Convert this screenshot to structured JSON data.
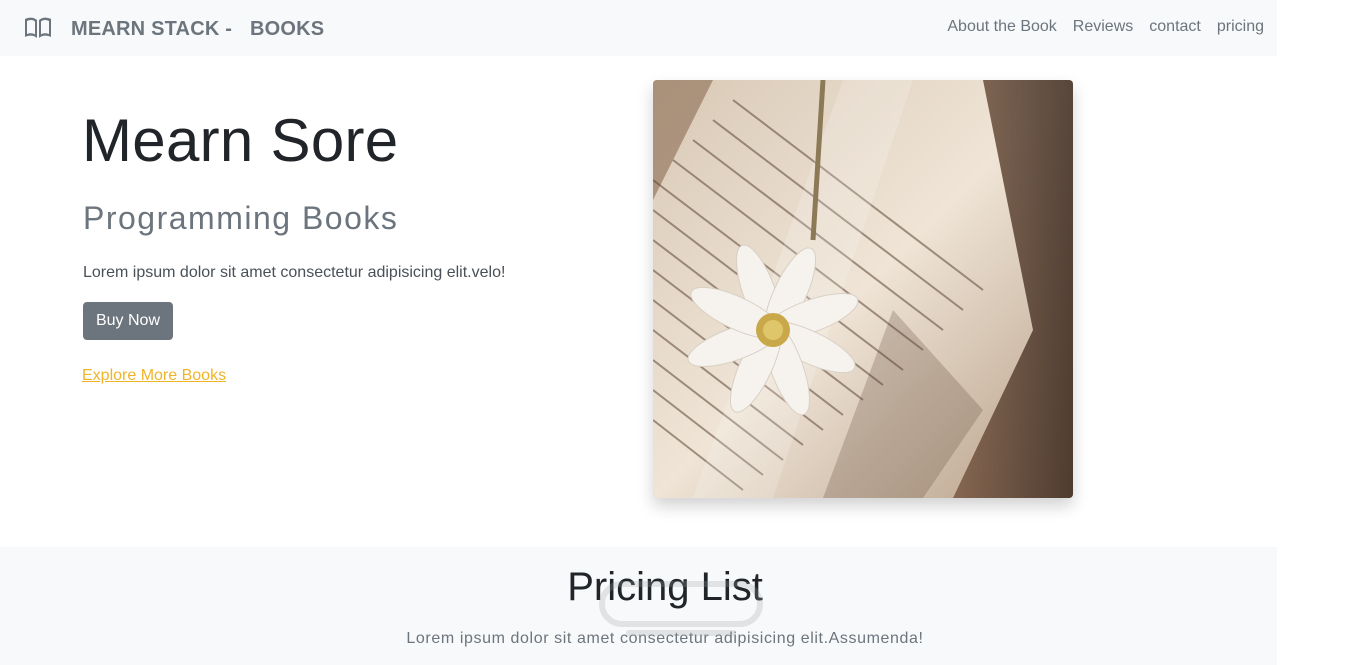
{
  "navbar": {
    "brand_part1": "MEARN STACK -",
    "brand_part2": "BOOKS",
    "brand_icon": "book-icon",
    "links": [
      "About the Book",
      "Reviews",
      "contact",
      "pricing"
    ]
  },
  "hero": {
    "title": "Mearn Sore",
    "subtitle": "Programming Books",
    "text": "Lorem ipsum dolor sit amet consectetur adipisicing elit.velo!",
    "buy_label": "Buy Now",
    "explore_label": "Explore More Books"
  },
  "pricing": {
    "title": "Pricing List",
    "text": "Lorem ipsum dolor sit amet consectetur adipisicing elit.Assumenda!"
  },
  "colors": {
    "navbar_bg": "#f8f9fa",
    "muted": "#6c757d",
    "link_accent": "#f0b429",
    "button_bg": "#6c757d"
  }
}
